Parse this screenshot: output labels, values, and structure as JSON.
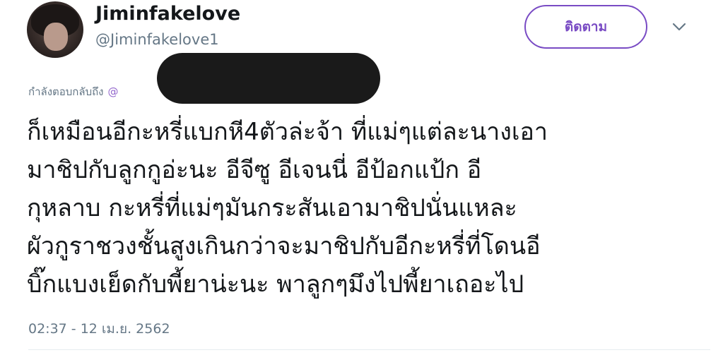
{
  "user": {
    "display_name": "Jiminfakelove",
    "screen_name": "@Jiminfakelove1"
  },
  "follow_button": {
    "label": "ติดตาม"
  },
  "reply_context": {
    "prefix": "กำลังตอบกลับถึง",
    "mention": "@"
  },
  "tweet": {
    "lines": [
      "ก็เหมือนอีกะหรี่แบกหี4ตัวล่ะจ้า ที่แม่ๆแต่ละนางเอา",
      "มาชิปกับลูกกูอ่ะนะ อีจีซู อีเจนนี่ อีป้อกแป้ก อี",
      "กุหลาบ กะหรี่ที่แม่ๆมันกระสันเอามาชิปนั่นแหละ",
      "ผัวกูราชวงชั้นสูงเกินกว่าจะมาชิปกับอีกะหรี่ที่โดนอี",
      "บิ๊กแบงเย็ดกับพี้ยาน่ะนะ พาลูกๆมึงไปพี้ยาเถอะไป"
    ],
    "timestamp": "02:37 - 12 เม.ย. 2562"
  },
  "icons": {
    "avatar": "avatar-photo",
    "more": "chevron-down-icon"
  },
  "colors": {
    "accent": "#794bc4",
    "secondary_text": "#657786",
    "mention": "#9266cc"
  }
}
